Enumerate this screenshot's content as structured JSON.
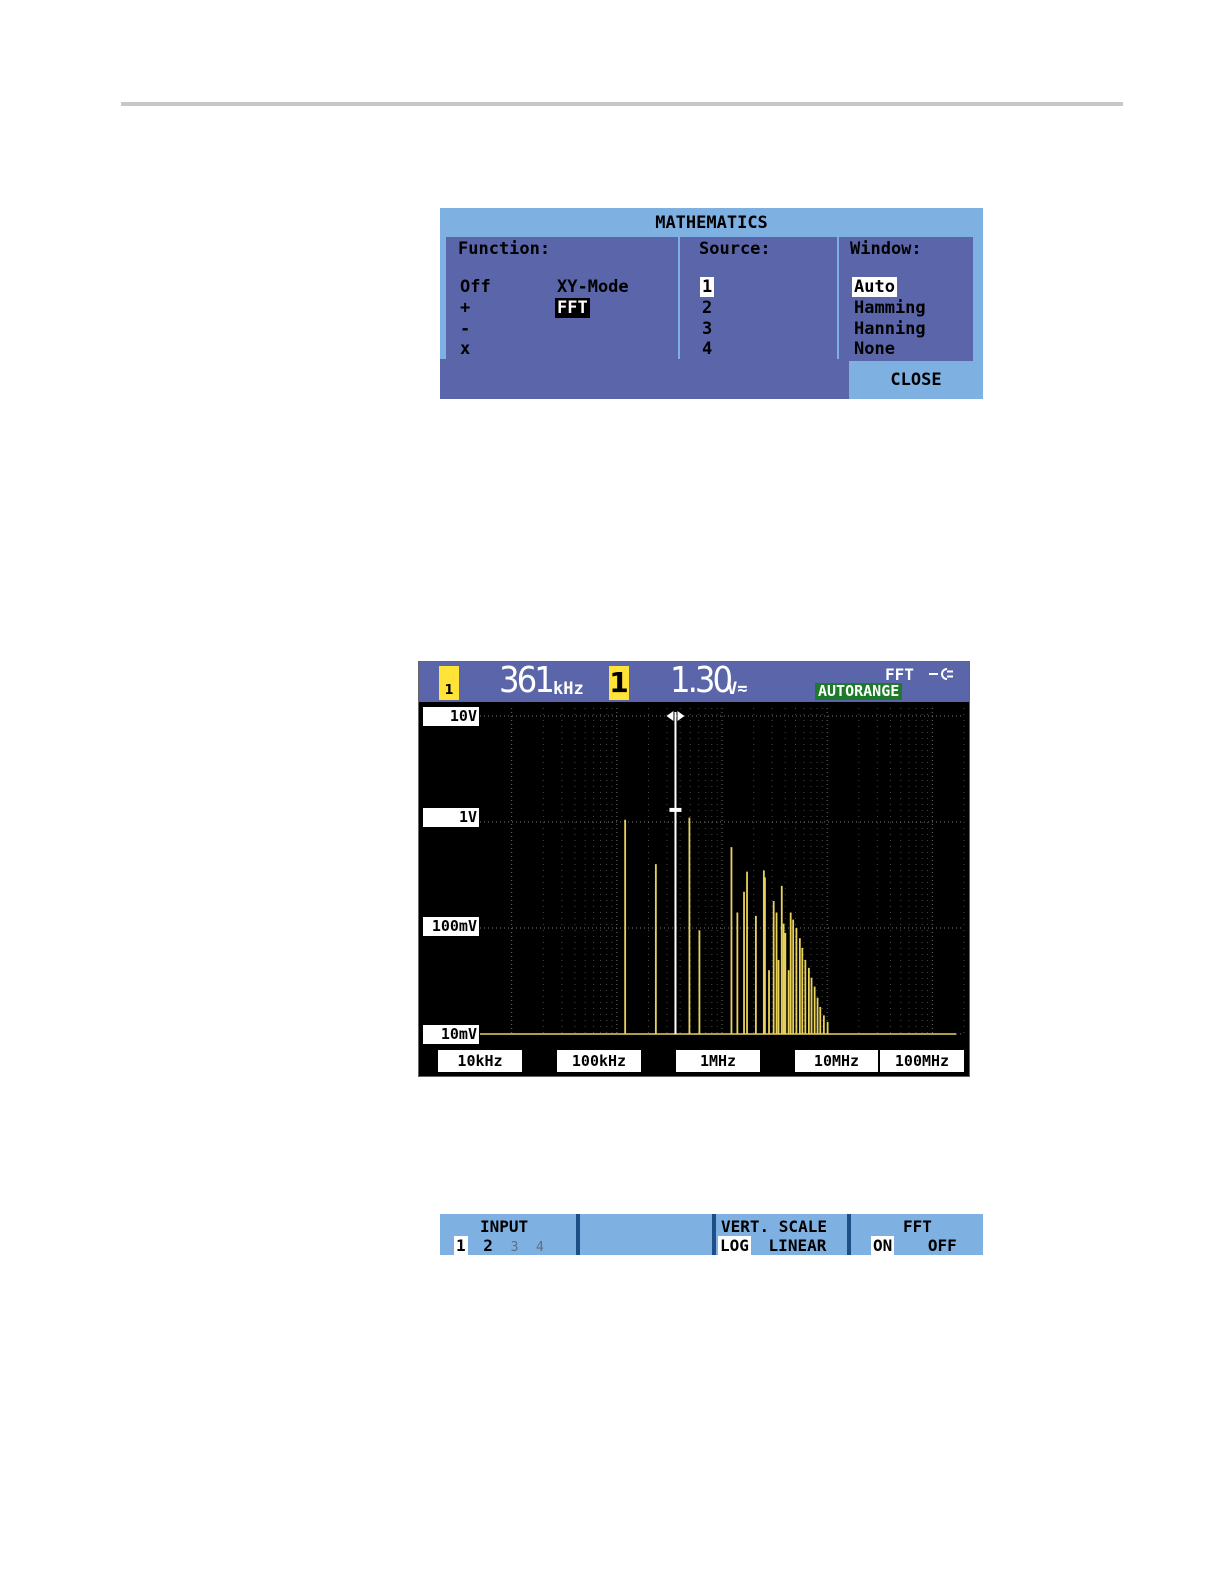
{
  "math_menu": {
    "title": "MATHEMATICS",
    "function": {
      "header": "Function:",
      "options": [
        "Off",
        "+",
        "-",
        "x"
      ],
      "options_right": [
        "XY-Mode",
        "FFT"
      ],
      "selected": "FFT"
    },
    "source": {
      "header": "Source:",
      "options": [
        "1",
        "2",
        "3",
        "4"
      ],
      "selected": "1"
    },
    "window": {
      "header": "Window:",
      "options": [
        "Auto",
        "Hamming",
        "Hanning",
        "None"
      ],
      "selected": "Auto"
    },
    "close_label": "CLOSE"
  },
  "scope": {
    "channel_tag_1": "1",
    "reading_1_value": "361",
    "reading_1_unit": "kHz",
    "channel_tag_2": "1",
    "reading_2_value": "1.30",
    "reading_2_unit": "V≂",
    "mode_label": "FFT",
    "autorange_label": "AUTORANGE",
    "y_labels": [
      "10V",
      "1V",
      "100mV",
      "10mV"
    ],
    "x_labels": [
      "10kHz",
      "100kHz",
      "1MHz",
      "10MHz",
      "100MHz"
    ],
    "colors": {
      "trace": "#e8d25a",
      "cursor": "#ffffff",
      "grid": "#7a7a7a"
    }
  },
  "chart_data": {
    "type": "bar",
    "x_scale": "log",
    "y_scale": "log",
    "ylim_volts": [
      0.01,
      10
    ],
    "xlim_hz": [
      5000,
      200000000
    ],
    "cursor_freq_hz": 361000,
    "spectral_lines": [
      {
        "freq_hz": 120000,
        "volts": 1.05
      },
      {
        "freq_hz": 235000,
        "volts": 0.4
      },
      {
        "freq_hz": 361000,
        "volts": 1.3
      },
      {
        "freq_hz": 490000,
        "volts": 1.1
      },
      {
        "freq_hz": 610000,
        "volts": 0.095
      },
      {
        "freq_hz": 1230000,
        "volts": 0.58
      },
      {
        "freq_hz": 1400000,
        "volts": 0.14
      },
      {
        "freq_hz": 1620000,
        "volts": 0.22
      },
      {
        "freq_hz": 1730000,
        "volts": 0.34
      },
      {
        "freq_hz": 2100000,
        "volts": 0.13
      },
      {
        "freq_hz": 2500000,
        "volts": 0.35
      },
      {
        "freq_hz": 2560000,
        "volts": 0.3
      },
      {
        "freq_hz": 2800000,
        "volts": 0.04
      },
      {
        "freq_hz": 3100000,
        "volts": 0.18
      },
      {
        "freq_hz": 3300000,
        "volts": 0.14
      },
      {
        "freq_hz": 3450000,
        "volts": 0.05
      },
      {
        "freq_hz": 3700000,
        "volts": 0.25
      },
      {
        "freq_hz": 3850000,
        "volts": 0.11
      },
      {
        "freq_hz": 4000000,
        "volts": 0.09
      },
      {
        "freq_hz": 4300000,
        "volts": 0.04
      },
      {
        "freq_hz": 4500000,
        "volts": 0.14
      },
      {
        "freq_hz": 4750000,
        "volts": 0.12
      },
      {
        "freq_hz": 5100000,
        "volts": 0.1
      },
      {
        "freq_hz": 5500000,
        "volts": 0.08
      },
      {
        "freq_hz": 5800000,
        "volts": 0.065
      },
      {
        "freq_hz": 6200000,
        "volts": 0.05
      },
      {
        "freq_hz": 6700000,
        "volts": 0.042
      },
      {
        "freq_hz": 7100000,
        "volts": 0.034
      },
      {
        "freq_hz": 7600000,
        "volts": 0.028
      },
      {
        "freq_hz": 8100000,
        "volts": 0.022
      },
      {
        "freq_hz": 8600000,
        "volts": 0.018
      },
      {
        "freq_hz": 9300000,
        "volts": 0.015
      },
      {
        "freq_hz": 10100000,
        "volts": 0.013
      }
    ]
  },
  "softkeys": {
    "input_label": "INPUT",
    "input_options": [
      "1",
      "2",
      "3",
      "4"
    ],
    "input_selected": "1",
    "vert_scale_label": "VERT. SCALE",
    "vert_scale_log": "LOG",
    "vert_scale_linear": "LINEAR",
    "fft_label": "FFT",
    "fft_on": "ON",
    "fft_off": "OFF"
  }
}
